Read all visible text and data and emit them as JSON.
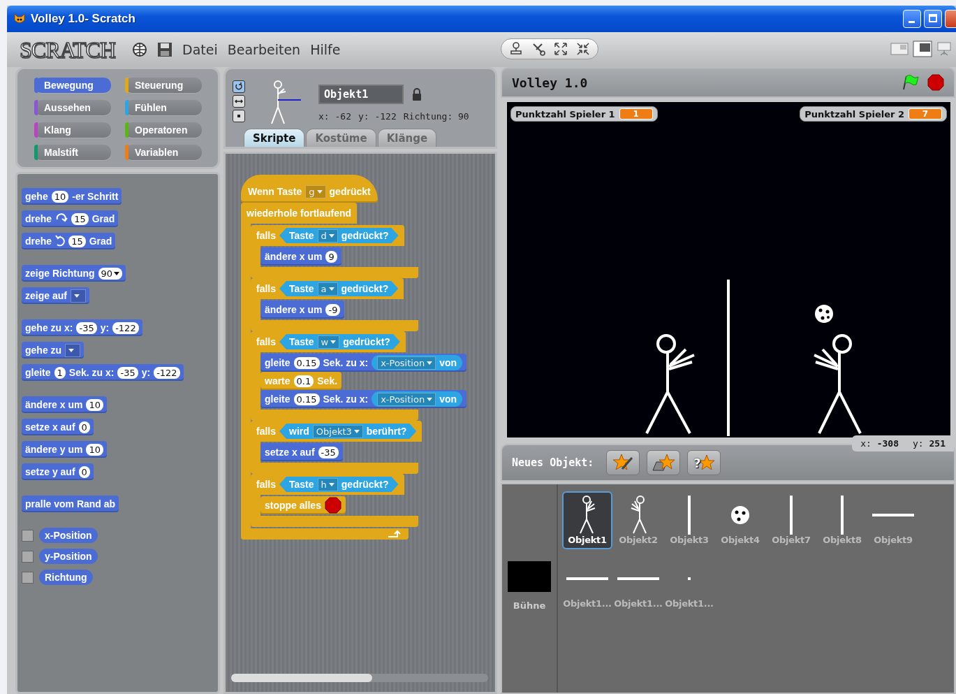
{
  "window": {
    "title": "Volley 1.0- Scratch"
  },
  "menu": {
    "logo": "SCRATCH",
    "items": [
      "Datei",
      "Bearbeiten",
      "Hilfe"
    ]
  },
  "categories": [
    {
      "label": "Bewegung",
      "color": "#4a6cd4",
      "selected": true
    },
    {
      "label": "Steuerung",
      "color": "#e1a91a",
      "selected": false
    },
    {
      "label": "Aussehen",
      "color": "#8a55d7",
      "selected": false
    },
    {
      "label": "Fühlen",
      "color": "#2ca5e2",
      "selected": false
    },
    {
      "label": "Klang",
      "color": "#bb42c3",
      "selected": false
    },
    {
      "label": "Operatoren",
      "color": "#5cb712",
      "selected": false
    },
    {
      "label": "Malstift",
      "color": "#0e9a6c",
      "selected": false
    },
    {
      "label": "Variablen",
      "color": "#ee7d16",
      "selected": false
    }
  ],
  "palette": {
    "groups": [
      [
        {
          "parts": [
            {
              "kind": "text",
              "text": "gehe"
            },
            {
              "kind": "num",
              "text": "10"
            },
            {
              "kind": "text",
              "text": "-er Schritt"
            }
          ]
        },
        {
          "parts": [
            {
              "kind": "text",
              "text": "drehe"
            },
            {
              "kind": "cw"
            },
            {
              "kind": "num",
              "text": "15"
            },
            {
              "kind": "text",
              "text": "Grad"
            }
          ]
        },
        {
          "parts": [
            {
              "kind": "text",
              "text": "drehe"
            },
            {
              "kind": "ccw"
            },
            {
              "kind": "num",
              "text": "15"
            },
            {
              "kind": "text",
              "text": "Grad"
            }
          ]
        }
      ],
      [
        {
          "parts": [
            {
              "kind": "text",
              "text": "zeige Richtung"
            },
            {
              "kind": "nummenu",
              "text": "90"
            }
          ]
        },
        {
          "parts": [
            {
              "kind": "text",
              "text": "zeige auf"
            },
            {
              "kind": "menu"
            }
          ]
        }
      ],
      [
        {
          "parts": [
            {
              "kind": "text",
              "text": "gehe zu x:"
            },
            {
              "kind": "num",
              "text": "-35"
            },
            {
              "kind": "text",
              "text": "y:"
            },
            {
              "kind": "num",
              "text": "-122"
            }
          ]
        },
        {
          "parts": [
            {
              "kind": "text",
              "text": "gehe zu"
            },
            {
              "kind": "menu"
            }
          ]
        },
        {
          "parts": [
            {
              "kind": "text",
              "text": "gleite"
            },
            {
              "kind": "num",
              "text": "1"
            },
            {
              "kind": "text",
              "text": "Sek. zu x:"
            },
            {
              "kind": "num",
              "text": "-35"
            },
            {
              "kind": "text",
              "text": "y:"
            },
            {
              "kind": "num",
              "text": "-122"
            }
          ]
        }
      ],
      [
        {
          "parts": [
            {
              "kind": "text",
              "text": "ändere x um"
            },
            {
              "kind": "num",
              "text": "10"
            }
          ]
        },
        {
          "parts": [
            {
              "kind": "text",
              "text": "setze x auf"
            },
            {
              "kind": "num",
              "text": "0"
            }
          ]
        },
        {
          "parts": [
            {
              "kind": "text",
              "text": "ändere y um"
            },
            {
              "kind": "num",
              "text": "10"
            }
          ]
        },
        {
          "parts": [
            {
              "kind": "text",
              "text": "setze y auf"
            },
            {
              "kind": "num",
              "text": "0"
            }
          ]
        }
      ],
      [
        {
          "parts": [
            {
              "kind": "text",
              "text": "pralle vom Rand ab"
            }
          ]
        }
      ]
    ],
    "reporters": [
      {
        "label": "x-Position",
        "checked": false
      },
      {
        "label": "y-Position",
        "checked": false
      },
      {
        "label": "Richtung",
        "checked": false
      }
    ]
  },
  "sprite_info": {
    "name": "Objekt1",
    "locked": true,
    "rotation_styles": [
      {
        "kind": "rotate",
        "selected": true
      },
      {
        "kind": "flip",
        "selected": false
      },
      {
        "kind": "none",
        "selected": false
      }
    ],
    "readout": [
      {
        "label": "x:",
        "value": "-62"
      },
      {
        "label": "y:",
        "value": "-122"
      },
      {
        "label": "Richtung:",
        "value": "90"
      }
    ],
    "tabs": [
      {
        "label": "Skripte",
        "selected": true
      },
      {
        "label": "Kostüme",
        "selected": false
      },
      {
        "label": "Klänge",
        "selected": false
      }
    ]
  },
  "script": [
    {
      "kind": "hat",
      "color": "#e1a91a",
      "parts": [
        {
          "kind": "text",
          "text": "Wenn Taste"
        },
        {
          "kind": "menu",
          "text": "g"
        },
        {
          "kind": "text",
          "text": "gedrückt"
        }
      ]
    },
    {
      "kind": "forever",
      "color": "#e1a91a",
      "parts": [
        {
          "kind": "text",
          "text": "wiederhole fortlaufend"
        }
      ],
      "children": [
        {
          "kind": "if",
          "color": "#e1a91a",
          "parts": [
            {
              "kind": "text",
              "text": "falls"
            },
            {
              "kind": "bool",
              "color": "#2ca5e2",
              "parts": [
                {
                  "kind": "text",
                  "text": "Taste"
                },
                {
                  "kind": "menu",
                  "text": "d"
                },
                {
                  "kind": "text",
                  "text": "gedrückt?"
                }
              ]
            }
          ],
          "children": [
            {
              "kind": "stack",
              "color": "#4a6cd4",
              "parts": [
                {
                  "kind": "text",
                  "text": "ändere x um"
                },
                {
                  "kind": "num",
                  "text": "9"
                }
              ]
            }
          ]
        },
        {
          "kind": "if",
          "color": "#e1a91a",
          "parts": [
            {
              "kind": "text",
              "text": "falls"
            },
            {
              "kind": "bool",
              "color": "#2ca5e2",
              "parts": [
                {
                  "kind": "text",
                  "text": "Taste"
                },
                {
                  "kind": "menu",
                  "text": "a"
                },
                {
                  "kind": "text",
                  "text": "gedrückt?"
                }
              ]
            }
          ],
          "children": [
            {
              "kind": "stack",
              "color": "#4a6cd4",
              "parts": [
                {
                  "kind": "text",
                  "text": "ändere x um"
                },
                {
                  "kind": "num",
                  "text": "-9"
                }
              ]
            }
          ]
        },
        {
          "kind": "if",
          "color": "#e1a91a",
          "parts": [
            {
              "kind": "text",
              "text": "falls"
            },
            {
              "kind": "bool",
              "color": "#2ca5e2",
              "parts": [
                {
                  "kind": "text",
                  "text": "Taste"
                },
                {
                  "kind": "menu",
                  "text": "w"
                },
                {
                  "kind": "text",
                  "text": "gedrückt?"
                }
              ]
            }
          ],
          "children": [
            {
              "kind": "stack",
              "color": "#4a6cd4",
              "parts": [
                {
                  "kind": "text",
                  "text": "gleite"
                },
                {
                  "kind": "num",
                  "text": "0.15"
                },
                {
                  "kind": "text",
                  "text": "Sek. zu x:"
                },
                {
                  "kind": "reporter",
                  "color": "#2ca5e2",
                  "parts": [
                    {
                      "kind": "menu",
                      "text": "x-Position"
                    },
                    {
                      "kind": "text",
                      "text": "von"
                    }
                  ]
                }
              ]
            },
            {
              "kind": "stack",
              "color": "#e1a91a",
              "parts": [
                {
                  "kind": "text",
                  "text": "warte"
                },
                {
                  "kind": "num",
                  "text": "0.1"
                },
                {
                  "kind": "text",
                  "text": "Sek."
                }
              ]
            },
            {
              "kind": "stack",
              "color": "#4a6cd4",
              "parts": [
                {
                  "kind": "text",
                  "text": "gleite"
                },
                {
                  "kind": "num",
                  "text": "0.15"
                },
                {
                  "kind": "text",
                  "text": "Sek. zu x:"
                },
                {
                  "kind": "reporter",
                  "color": "#2ca5e2",
                  "parts": [
                    {
                      "kind": "menu",
                      "text": "x-Position"
                    },
                    {
                      "kind": "text",
                      "text": "von"
                    }
                  ]
                }
              ]
            }
          ]
        },
        {
          "kind": "if",
          "color": "#e1a91a",
          "parts": [
            {
              "kind": "text",
              "text": "falls"
            },
            {
              "kind": "bool",
              "color": "#2ca5e2",
              "parts": [
                {
                  "kind": "text",
                  "text": "wird"
                },
                {
                  "kind": "menu",
                  "text": "Objekt3"
                },
                {
                  "kind": "text",
                  "text": "berührt?"
                }
              ]
            }
          ],
          "children": [
            {
              "kind": "stack",
              "color": "#4a6cd4",
              "parts": [
                {
                  "kind": "text",
                  "text": "setze x auf"
                },
                {
                  "kind": "num",
                  "text": "-35"
                }
              ]
            }
          ]
        },
        {
          "kind": "if",
          "color": "#e1a91a",
          "parts": [
            {
              "kind": "text",
              "text": "falls"
            },
            {
              "kind": "bool",
              "color": "#2ca5e2",
              "parts": [
                {
                  "kind": "text",
                  "text": "Taste"
                },
                {
                  "kind": "menu",
                  "text": "h"
                },
                {
                  "kind": "text",
                  "text": "gedrückt?"
                }
              ]
            }
          ],
          "children": [
            {
              "kind": "stack",
              "color": "#e1a91a",
              "parts": [
                {
                  "kind": "text",
                  "text": "stoppe alles"
                },
                {
                  "kind": "stop"
                }
              ]
            }
          ]
        }
      ]
    }
  ],
  "stage": {
    "title": "Volley 1.0",
    "monitors": [
      {
        "label": "Punktzahl Spieler 1",
        "value": "1"
      },
      {
        "label": "Punktzahl Spieler 2",
        "value": "7"
      }
    ],
    "cursor": [
      {
        "label": "x:",
        "value": "-308"
      },
      {
        "label": "y:",
        "value": "251"
      }
    ]
  },
  "new_sprite": {
    "label": "Neues Objekt:",
    "random_mark": "?"
  },
  "stage_thumb": {
    "label": "Bühne"
  },
  "sprites": [
    {
      "name": "Objekt1",
      "kind": "stick",
      "selected": true
    },
    {
      "name": "Objekt2",
      "kind": "stick-mirror",
      "selected": false
    },
    {
      "name": "Objekt3",
      "kind": "vline",
      "selected": false
    },
    {
      "name": "Objekt4",
      "kind": "ball",
      "selected": false
    },
    {
      "name": "Objekt7",
      "kind": "vline",
      "selected": false
    },
    {
      "name": "Objekt8",
      "kind": "vline",
      "selected": false
    },
    {
      "name": "Objekt9",
      "kind": "hline",
      "selected": false
    },
    {
      "name": "Objekt1...",
      "kind": "hline",
      "selected": false
    },
    {
      "name": "Objekt1...",
      "kind": "hline",
      "selected": false
    },
    {
      "name": "Objekt1...",
      "kind": "dot",
      "selected": false
    }
  ]
}
